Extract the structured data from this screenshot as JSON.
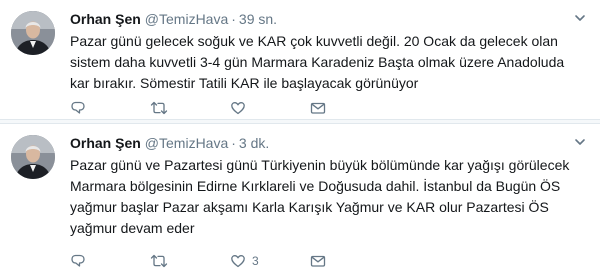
{
  "tweets": [
    {
      "name": "Orhan Şen",
      "handle": "@TemizHava",
      "separator": "·",
      "time": "39 sn.",
      "text": "Pazar günü gelecek soğuk ve KAR çok kuvvetli değil. 20 Ocak da gelecek olan sistem daha kuvvetli 3-4 gün Marmara Karadeniz Başta olmak üzere Anadoluda kar bırakır. Sömestir Tatili KAR ile başlayacak görünüyor",
      "reply_count": "",
      "retweet_count": "",
      "like_count": "",
      "avatar_icon": "profile-photo"
    },
    {
      "name": "Orhan Şen",
      "handle": "@TemizHava",
      "separator": "·",
      "time": "3 dk.",
      "text": "Pazar günü ve Pazartesi günü Türkiyenin büyük bölümünde kar yağışı görülecek Marmara bölgesinin Edirne Kırklareli ve Doğusuda dahil. İstanbul da Bugün ÖS yağmur başlar Pazar akşamı Karla Karışık Yağmur ve KAR olur Pazartesi ÖS yağmur devam eder",
      "reply_count": "",
      "retweet_count": "",
      "like_count": "3",
      "avatar_icon": "profile-photo"
    }
  ],
  "colors": {
    "text": "#14171a",
    "secondary": "#657786",
    "divider": "#e1e8ed",
    "divider_bg": "#f5f8fa"
  }
}
